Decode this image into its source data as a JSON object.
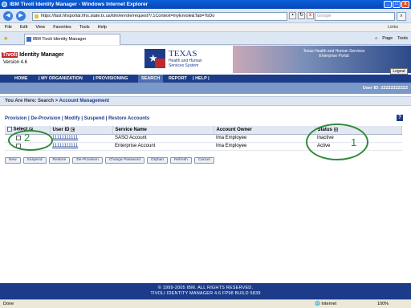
{
  "window": {
    "title": "IBM Tivoli Identity Manager - Windows Internet Explorer",
    "min": "_",
    "max": "□",
    "close": "x"
  },
  "browser": {
    "back": "◀",
    "forward": "▶",
    "url": "https://fast.hhsportal.hhs.state.tx.us/itim/enrole/request?/,1Context=myEnrole&Tab=ToDo",
    "search_placeholder": "Google",
    "menu": [
      "File",
      "Edit",
      "View",
      "Favorites",
      "Tools",
      "Help"
    ],
    "links_label": "Links",
    "tab_title": "IBM Tivoli Identity Manager",
    "commands": [
      "Page",
      "Tools"
    ]
  },
  "banner": {
    "tivoli": "Tivoli",
    "product": "Identity Manager",
    "version": "Version 4.6",
    "texas_title": "TEXAS",
    "texas_sub": "Health and Human Services System",
    "portal_line1": "Texas Health and Human Services",
    "portal_line2": "Enterprise Portal",
    "logout": "Logout"
  },
  "nav": {
    "items": [
      "HOME",
      "| MY ORGANIZATION",
      "| PROVISIONING",
      "SEARCH",
      "REPORT",
      "| HELP |"
    ],
    "user_id": "User ID: 22222222222"
  },
  "breadcrumb": {
    "prefix": "You Are Here: Search >",
    "current": "Account Management"
  },
  "actions": {
    "text": "Provision | De-Provision | Modify | Suspend | Restore Accounts"
  },
  "table": {
    "headers": [
      "Select",
      "User ID",
      "Service Name",
      "Account Owner",
      "Status"
    ],
    "rows": [
      {
        "user_id": "11111111111",
        "service": "SASO Account",
        "owner": "Ima Employee",
        "status": "Inactive"
      },
      {
        "user_id": "11111111111",
        "service": "Enterprise Account",
        "owner": "Ima Employee",
        "status": "Active"
      }
    ]
  },
  "buttons": [
    "New",
    "Suspend",
    "Restore",
    "De-Provision",
    "Change Password",
    "Orphan",
    "Refresh",
    "Cancel"
  ],
  "annotations": {
    "one": "1",
    "two": "2"
  },
  "footer": {
    "line1": "© 1999-2005 IBM. ALL RIGHTS RESERVED.",
    "line2": "TIVOLI IDENTITY MANAGER 4.6 FP98 BUILD 5839"
  },
  "statusbar": {
    "status": "Done",
    "zone": "Internet",
    "zoom": "100%"
  },
  "colors": {
    "nav_blue": "#1c3c8a",
    "annotation_green": "#2f8a3a",
    "tivoli_red": "#c0282d"
  }
}
